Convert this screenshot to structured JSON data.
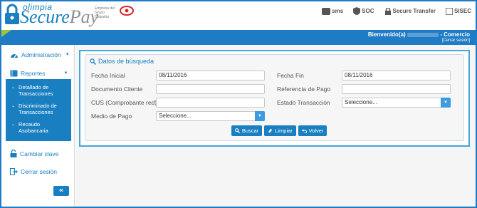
{
  "header": {
    "brand_top": "olimpia",
    "brand_secure": "Secure",
    "brand_pay": "Pay",
    "empresa_text": "Empresa del Grupo Colpatria",
    "brands": [
      {
        "name": "sms",
        "icon": "olimpia-sms-logo"
      },
      {
        "name": "SOC",
        "icon": "olimpia-soc-logo"
      },
      {
        "name": "Secure Transfer",
        "icon": "olimpia-secure-transfer-logo"
      },
      {
        "name": "SISEC",
        "icon": "olimpia-sisec-logo"
      }
    ]
  },
  "topbar": {
    "welcome_prefix": "Bienvenido(a)",
    "welcome_suffix": "- Comercio",
    "logout": "[Cerrar sesión]",
    "accent_color": "#1e7bc4",
    "triangle_color": "#9ec53a"
  },
  "sidebar": {
    "administracion": "Administración",
    "reportes": "Reportes",
    "sub": [
      {
        "label": "Detallado de Transacciones"
      },
      {
        "label": "Discriminado de Transacciones"
      },
      {
        "label": "Recaudo Asobancaria"
      }
    ],
    "cambiar_clave": "Cambiar clave",
    "cerrar_sesion": "Cerrar sesión",
    "collapse": "«"
  },
  "form": {
    "title": "Datos de búsqueda",
    "fecha_inicial_label": "Fecha Inicial",
    "fecha_inicial_value": "08/11/2016",
    "fecha_fin_label": "Fecha Fin",
    "fecha_fin_value": "08/11/2016",
    "documento_label": "Documento Cliente",
    "documento_value": "",
    "referencia_label": "Referencia de Pago",
    "referencia_value": "",
    "cus_label": "CUS (Comprobante red)",
    "cus_value": "",
    "estado_label": "Estado Transacción",
    "estado_value": "Seleccione...",
    "medio_label": "Medio de Pago",
    "medio_value": "Seleccione...",
    "buscar": "Buscar",
    "limpiar": "Limpiar",
    "volver": "Volver"
  }
}
